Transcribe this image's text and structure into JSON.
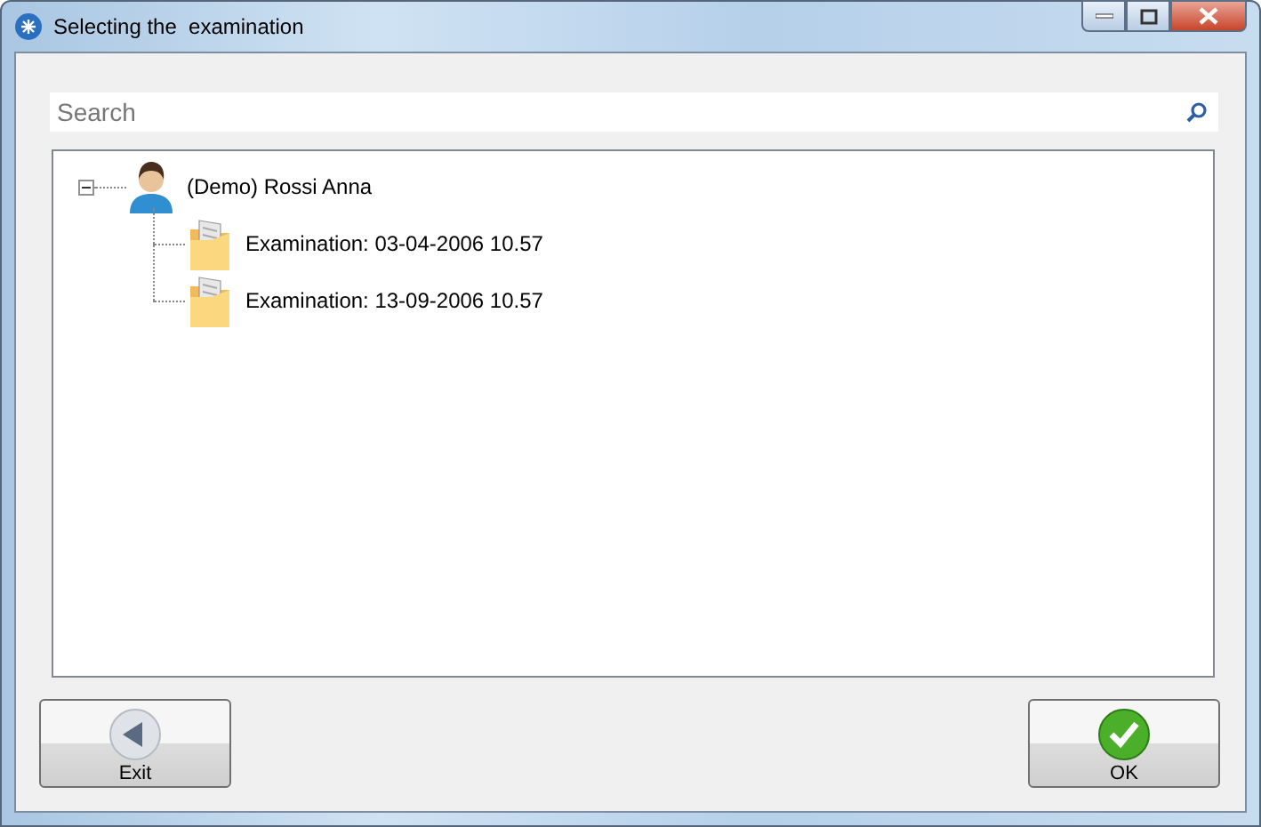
{
  "window": {
    "title": "Selecting the  examination"
  },
  "search": {
    "placeholder": "Search"
  },
  "tree": {
    "items": [
      {
        "label": "(Demo) Rossi Anna",
        "kind": "patient",
        "expanded": true,
        "children": [
          {
            "label": "Examination: 03-04-2006 10.57",
            "kind": "examination"
          },
          {
            "label": "Examination: 13-09-2006 10.57",
            "kind": "examination"
          }
        ]
      }
    ]
  },
  "buttons": [
    {
      "label": "Exit",
      "kind": "back"
    },
    {
      "label": "OK",
      "kind": "ok"
    }
  ]
}
